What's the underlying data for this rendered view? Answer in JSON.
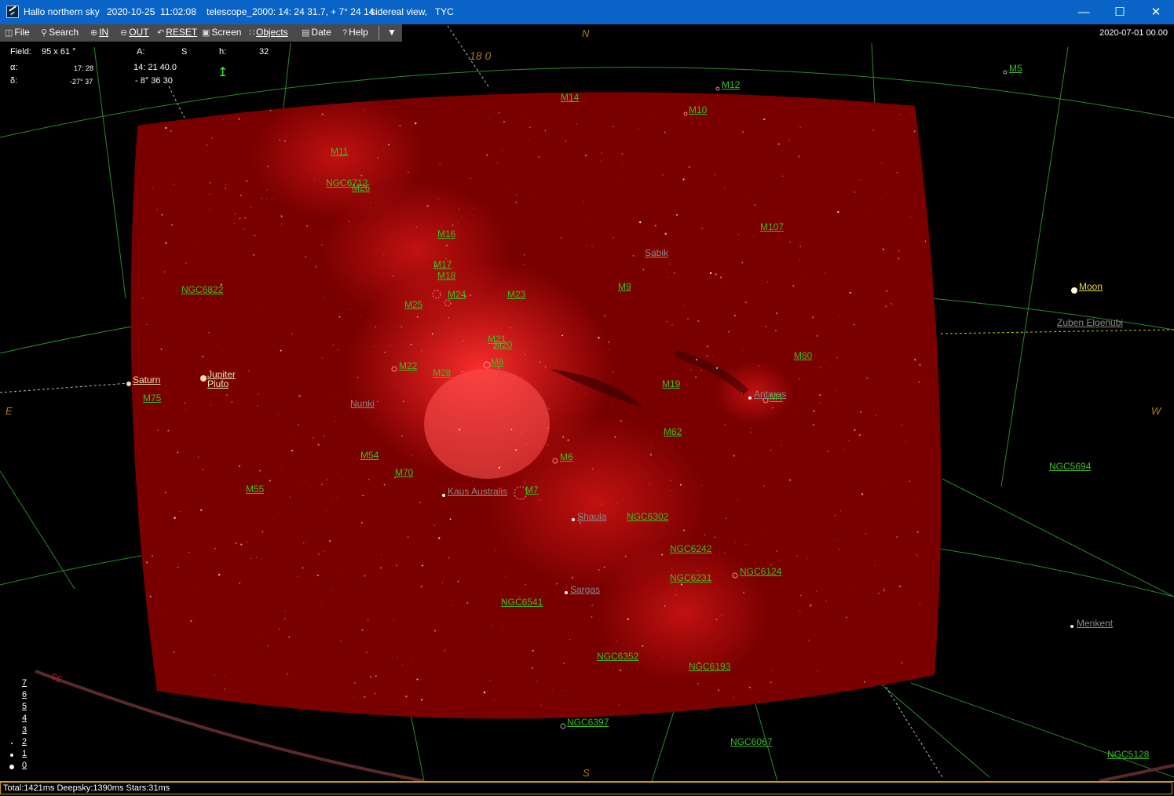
{
  "titlebar": {
    "app": "Hallo northern sky",
    "datetime": "2020-10-25  11:02:08",
    "telescope": "telescope_2000: 14: 24 31.7, + 7° 24 14",
    "view": "sidereal view,   TYC"
  },
  "toolbar": {
    "file": "File",
    "search": "Search",
    "in": "IN",
    "out": "OUT",
    "reset": "RESET",
    "screen": "Screen",
    "objects": "Objects",
    "date": "Date",
    "help": "Help"
  },
  "date_display": "2020-07-01  00.00",
  "info": {
    "field_label": "Field:",
    "field_value": "95  x    61 °",
    "a_label": "A:",
    "a_value": "S",
    "h_label": "h:",
    "h_value": "32",
    "alpha_label": "α:",
    "alpha_value": "17: 28",
    "alpha_value2": "14: 21 40.0",
    "delta_label": "δ:",
    "delta_value": "-27° 37",
    "delta_value2": "- 8° 36 30"
  },
  "cardinals": {
    "n": "N",
    "e": "E",
    "w": "W",
    "s": "S",
    "se": "SE",
    "ra_label": "18   0"
  },
  "objects": {
    "m5": "M5",
    "m12": "M12",
    "m14": "M14",
    "m10": "M10",
    "m11": "M11",
    "ngc6712": "NGC6712",
    "m26": "M26",
    "m16": "M16",
    "m107": "M107",
    "sabik": "Sabik",
    "m17": "M17",
    "m18": "M18",
    "ngc6822": "NGC6822",
    "m24": "M24",
    "m23": "M23",
    "m9": "M9",
    "m25": "M25",
    "moon": "Moon",
    "zuben": "Zuben Elgenubi",
    "m21": "M21",
    "m20": "M20",
    "m8": "M8",
    "m80": "M80",
    "m22": "M22",
    "m28": "M28",
    "jupiter": "Jupiter",
    "pluto": "Pluto",
    "saturn": "Saturn",
    "m19": "M19",
    "antares": "Antares",
    "m4": "M4",
    "m75": "M75",
    "nunki": "Nunki",
    "m62": "M62",
    "m54": "M54",
    "m6": "M6",
    "m70": "M70",
    "ngc5694": "NGC5694",
    "m55": "M55",
    "kaus": "Kaus Australis",
    "m7": "M7",
    "shaula": "Shaula",
    "ngc6302": "NGC6302",
    "ngc6242": "NGC6242",
    "ngc6124": "NGC6124",
    "ngc6231": "NGC6231",
    "sargas": "Sargas",
    "ngc6541": "NGC6541",
    "menkent": "Menkent",
    "ngc6352": "NGC6352",
    "ngc6193": "NGC6193",
    "ngc6397": "NGC6397",
    "ngc6067": "NGC6067",
    "ngc5128": "NGC5128"
  },
  "magnitude_scale": [
    "7",
    "6",
    "5",
    "4",
    "3",
    "2",
    "1",
    "0"
  ],
  "status": "Total:1421ms  Deepsky:1390ms  Stars:31ms",
  "colors": {
    "sky": "#000000",
    "milkyway": "#b00000",
    "grid": "#2a9a2a",
    "deepsky_label": "#3cbd1e",
    "horizon": "#4a2020"
  }
}
